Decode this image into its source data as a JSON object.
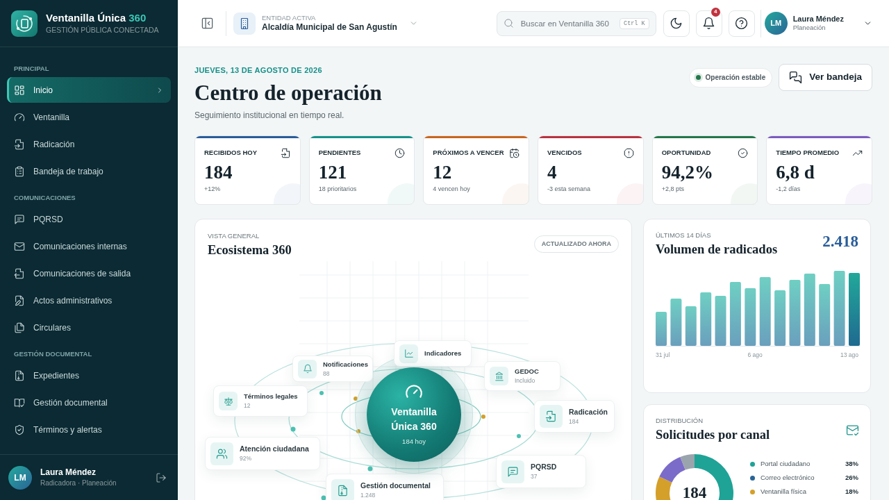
{
  "brand": {
    "name": "Ventanilla Única",
    "accent": "360",
    "tagline": "GESTIÓN PÚBLICA CONECTADA"
  },
  "sidebar": {
    "sections": [
      {
        "title": "PRINCIPAL",
        "items": [
          {
            "label": "Inicio",
            "selected": true
          },
          {
            "label": "Ventanilla",
            "selected": false
          },
          {
            "label": "Radicación",
            "selected": false
          },
          {
            "label": "Bandeja de trabajo",
            "selected": false
          }
        ]
      },
      {
        "title": "COMUNICACIONES",
        "items": [
          {
            "label": "PQRSD",
            "selected": false
          },
          {
            "label": "Comunicaciones internas",
            "selected": false
          },
          {
            "label": "Comunicaciones de salida",
            "selected": false
          },
          {
            "label": "Actos administrativos",
            "selected": false
          },
          {
            "label": "Circulares",
            "selected": false
          }
        ]
      },
      {
        "title": "GESTIÓN DOCUMENTAL",
        "items": [
          {
            "label": "Expedientes",
            "selected": false
          },
          {
            "label": "Gestión documental",
            "selected": false
          },
          {
            "label": "Términos y alertas",
            "selected": false
          }
        ]
      }
    ],
    "user": {
      "initials": "LM",
      "name": "Laura Méndez",
      "role": "Radicadora · Planeación"
    }
  },
  "header": {
    "entity_label": "ENTIDAD ACTIVA",
    "entity": "Alcaldía Municipal de San Agustín",
    "search": {
      "placeholder": "Buscar en Ventanilla 360",
      "shortcut": "Ctrl K"
    },
    "notifications_badge": "4",
    "user": {
      "initials": "LM",
      "name": "Laura Méndez",
      "role": "Planeación"
    }
  },
  "page": {
    "date": "JUEVES, 13 DE AGOSTO DE 2026",
    "title": "Centro de operación",
    "subtitle": "Seguimiento institucional en tiempo real.",
    "status": "Operación estable",
    "action": "Ver bandeja"
  },
  "stats": [
    {
      "label": "RECIBIDOS HOY",
      "value": "184",
      "delta": "+12%",
      "color": "#2a5d9a"
    },
    {
      "label": "PENDIENTES",
      "value": "121",
      "delta": "18 prioritarios",
      "color": "#16918a"
    },
    {
      "label": "PRÓXIMOS A VENCER",
      "value": "12",
      "delta": "4 vencen hoy",
      "color": "#c8661f"
    },
    {
      "label": "VENCIDOS",
      "value": "4",
      "delta": "-3 esta semana",
      "color": "#b8333f"
    },
    {
      "label": "OPORTUNIDAD",
      "value": "94,2%",
      "delta": "+2,8 pts",
      "color": "#23774a"
    },
    {
      "label": "TIEMPO PROMEDIO",
      "value": "6,8 d",
      "delta": "-1,2 días",
      "color": "#7b5cc0"
    }
  ],
  "ecosystem": {
    "eyebrow": "VISTA GENERAL",
    "title": "Ecosistema 360",
    "updated": "ACTUALIZADO AHORA",
    "hub": {
      "title": "Ventanilla Única 360",
      "sub": "184 hoy"
    },
    "nodes": [
      {
        "title": "Notificaciones",
        "sub": "88"
      },
      {
        "title": "Indicadores"
      },
      {
        "title": "GEDOC",
        "sub": "Incluido"
      },
      {
        "title": "Términos legales",
        "sub": "12"
      },
      {
        "title": "Radicación",
        "sub": "184"
      },
      {
        "title": "Atención ciudadana",
        "sub": "92%"
      },
      {
        "title": "PQRSD",
        "sub": "37"
      },
      {
        "title": "Gestión documental",
        "sub": "1.248"
      }
    ]
  },
  "volume": {
    "eyebrow": "ÚLTIMOS 14 DÍAS",
    "title": "Volumen de radicados",
    "total": "2.418",
    "axis_labels": [
      "31 jul",
      "6 ago",
      "13 ago"
    ]
  },
  "channels": {
    "eyebrow": "DISTRIBUCIÓN",
    "title": "Solicitudes por canal",
    "total": "184",
    "legend": [
      {
        "label": "Portal ciudadano",
        "value": "38%",
        "color": "#1fa396"
      },
      {
        "label": "Correo electrónico",
        "value": "26%",
        "color": "#2a6596"
      },
      {
        "label": "Ventanilla física",
        "value": "18%",
        "color": "#d4a02a"
      }
    ]
  }
}
